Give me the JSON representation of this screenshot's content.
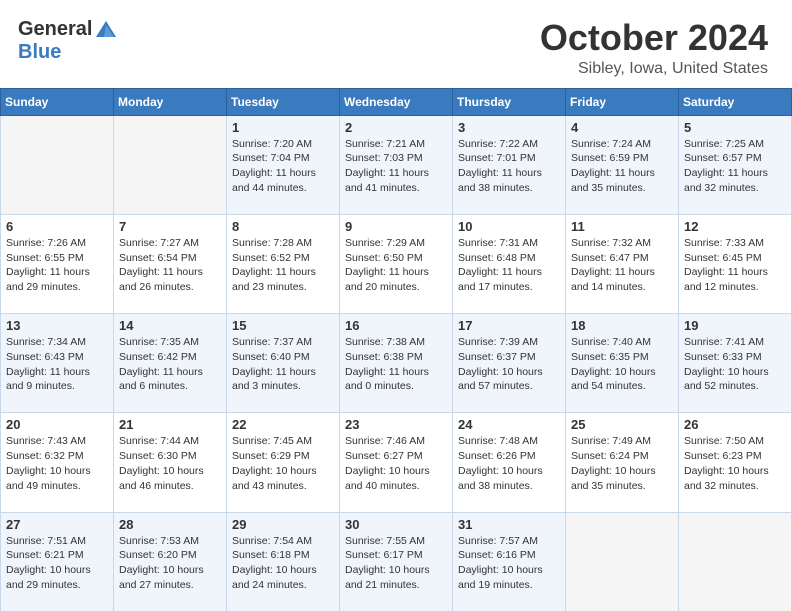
{
  "header": {
    "logo_general": "General",
    "logo_blue": "Blue",
    "month_title": "October 2024",
    "location": "Sibley, Iowa, United States"
  },
  "weekdays": [
    "Sunday",
    "Monday",
    "Tuesday",
    "Wednesday",
    "Thursday",
    "Friday",
    "Saturday"
  ],
  "weeks": [
    [
      {
        "day": "",
        "sunrise": "",
        "sunset": "",
        "daylight": ""
      },
      {
        "day": "",
        "sunrise": "",
        "sunset": "",
        "daylight": ""
      },
      {
        "day": "1",
        "sunrise": "Sunrise: 7:20 AM",
        "sunset": "Sunset: 7:04 PM",
        "daylight": "Daylight: 11 hours and 44 minutes."
      },
      {
        "day": "2",
        "sunrise": "Sunrise: 7:21 AM",
        "sunset": "Sunset: 7:03 PM",
        "daylight": "Daylight: 11 hours and 41 minutes."
      },
      {
        "day": "3",
        "sunrise": "Sunrise: 7:22 AM",
        "sunset": "Sunset: 7:01 PM",
        "daylight": "Daylight: 11 hours and 38 minutes."
      },
      {
        "day": "4",
        "sunrise": "Sunrise: 7:24 AM",
        "sunset": "Sunset: 6:59 PM",
        "daylight": "Daylight: 11 hours and 35 minutes."
      },
      {
        "day": "5",
        "sunrise": "Sunrise: 7:25 AM",
        "sunset": "Sunset: 6:57 PM",
        "daylight": "Daylight: 11 hours and 32 minutes."
      }
    ],
    [
      {
        "day": "6",
        "sunrise": "Sunrise: 7:26 AM",
        "sunset": "Sunset: 6:55 PM",
        "daylight": "Daylight: 11 hours and 29 minutes."
      },
      {
        "day": "7",
        "sunrise": "Sunrise: 7:27 AM",
        "sunset": "Sunset: 6:54 PM",
        "daylight": "Daylight: 11 hours and 26 minutes."
      },
      {
        "day": "8",
        "sunrise": "Sunrise: 7:28 AM",
        "sunset": "Sunset: 6:52 PM",
        "daylight": "Daylight: 11 hours and 23 minutes."
      },
      {
        "day": "9",
        "sunrise": "Sunrise: 7:29 AM",
        "sunset": "Sunset: 6:50 PM",
        "daylight": "Daylight: 11 hours and 20 minutes."
      },
      {
        "day": "10",
        "sunrise": "Sunrise: 7:31 AM",
        "sunset": "Sunset: 6:48 PM",
        "daylight": "Daylight: 11 hours and 17 minutes."
      },
      {
        "day": "11",
        "sunrise": "Sunrise: 7:32 AM",
        "sunset": "Sunset: 6:47 PM",
        "daylight": "Daylight: 11 hours and 14 minutes."
      },
      {
        "day": "12",
        "sunrise": "Sunrise: 7:33 AM",
        "sunset": "Sunset: 6:45 PM",
        "daylight": "Daylight: 11 hours and 12 minutes."
      }
    ],
    [
      {
        "day": "13",
        "sunrise": "Sunrise: 7:34 AM",
        "sunset": "Sunset: 6:43 PM",
        "daylight": "Daylight: 11 hours and 9 minutes."
      },
      {
        "day": "14",
        "sunrise": "Sunrise: 7:35 AM",
        "sunset": "Sunset: 6:42 PM",
        "daylight": "Daylight: 11 hours and 6 minutes."
      },
      {
        "day": "15",
        "sunrise": "Sunrise: 7:37 AM",
        "sunset": "Sunset: 6:40 PM",
        "daylight": "Daylight: 11 hours and 3 minutes."
      },
      {
        "day": "16",
        "sunrise": "Sunrise: 7:38 AM",
        "sunset": "Sunset: 6:38 PM",
        "daylight": "Daylight: 11 hours and 0 minutes."
      },
      {
        "day": "17",
        "sunrise": "Sunrise: 7:39 AM",
        "sunset": "Sunset: 6:37 PM",
        "daylight": "Daylight: 10 hours and 57 minutes."
      },
      {
        "day": "18",
        "sunrise": "Sunrise: 7:40 AM",
        "sunset": "Sunset: 6:35 PM",
        "daylight": "Daylight: 10 hours and 54 minutes."
      },
      {
        "day": "19",
        "sunrise": "Sunrise: 7:41 AM",
        "sunset": "Sunset: 6:33 PM",
        "daylight": "Daylight: 10 hours and 52 minutes."
      }
    ],
    [
      {
        "day": "20",
        "sunrise": "Sunrise: 7:43 AM",
        "sunset": "Sunset: 6:32 PM",
        "daylight": "Daylight: 10 hours and 49 minutes."
      },
      {
        "day": "21",
        "sunrise": "Sunrise: 7:44 AM",
        "sunset": "Sunset: 6:30 PM",
        "daylight": "Daylight: 10 hours and 46 minutes."
      },
      {
        "day": "22",
        "sunrise": "Sunrise: 7:45 AM",
        "sunset": "Sunset: 6:29 PM",
        "daylight": "Daylight: 10 hours and 43 minutes."
      },
      {
        "day": "23",
        "sunrise": "Sunrise: 7:46 AM",
        "sunset": "Sunset: 6:27 PM",
        "daylight": "Daylight: 10 hours and 40 minutes."
      },
      {
        "day": "24",
        "sunrise": "Sunrise: 7:48 AM",
        "sunset": "Sunset: 6:26 PM",
        "daylight": "Daylight: 10 hours and 38 minutes."
      },
      {
        "day": "25",
        "sunrise": "Sunrise: 7:49 AM",
        "sunset": "Sunset: 6:24 PM",
        "daylight": "Daylight: 10 hours and 35 minutes."
      },
      {
        "day": "26",
        "sunrise": "Sunrise: 7:50 AM",
        "sunset": "Sunset: 6:23 PM",
        "daylight": "Daylight: 10 hours and 32 minutes."
      }
    ],
    [
      {
        "day": "27",
        "sunrise": "Sunrise: 7:51 AM",
        "sunset": "Sunset: 6:21 PM",
        "daylight": "Daylight: 10 hours and 29 minutes."
      },
      {
        "day": "28",
        "sunrise": "Sunrise: 7:53 AM",
        "sunset": "Sunset: 6:20 PM",
        "daylight": "Daylight: 10 hours and 27 minutes."
      },
      {
        "day": "29",
        "sunrise": "Sunrise: 7:54 AM",
        "sunset": "Sunset: 6:18 PM",
        "daylight": "Daylight: 10 hours and 24 minutes."
      },
      {
        "day": "30",
        "sunrise": "Sunrise: 7:55 AM",
        "sunset": "Sunset: 6:17 PM",
        "daylight": "Daylight: 10 hours and 21 minutes."
      },
      {
        "day": "31",
        "sunrise": "Sunrise: 7:57 AM",
        "sunset": "Sunset: 6:16 PM",
        "daylight": "Daylight: 10 hours and 19 minutes."
      },
      {
        "day": "",
        "sunrise": "",
        "sunset": "",
        "daylight": ""
      },
      {
        "day": "",
        "sunrise": "",
        "sunset": "",
        "daylight": ""
      }
    ]
  ]
}
